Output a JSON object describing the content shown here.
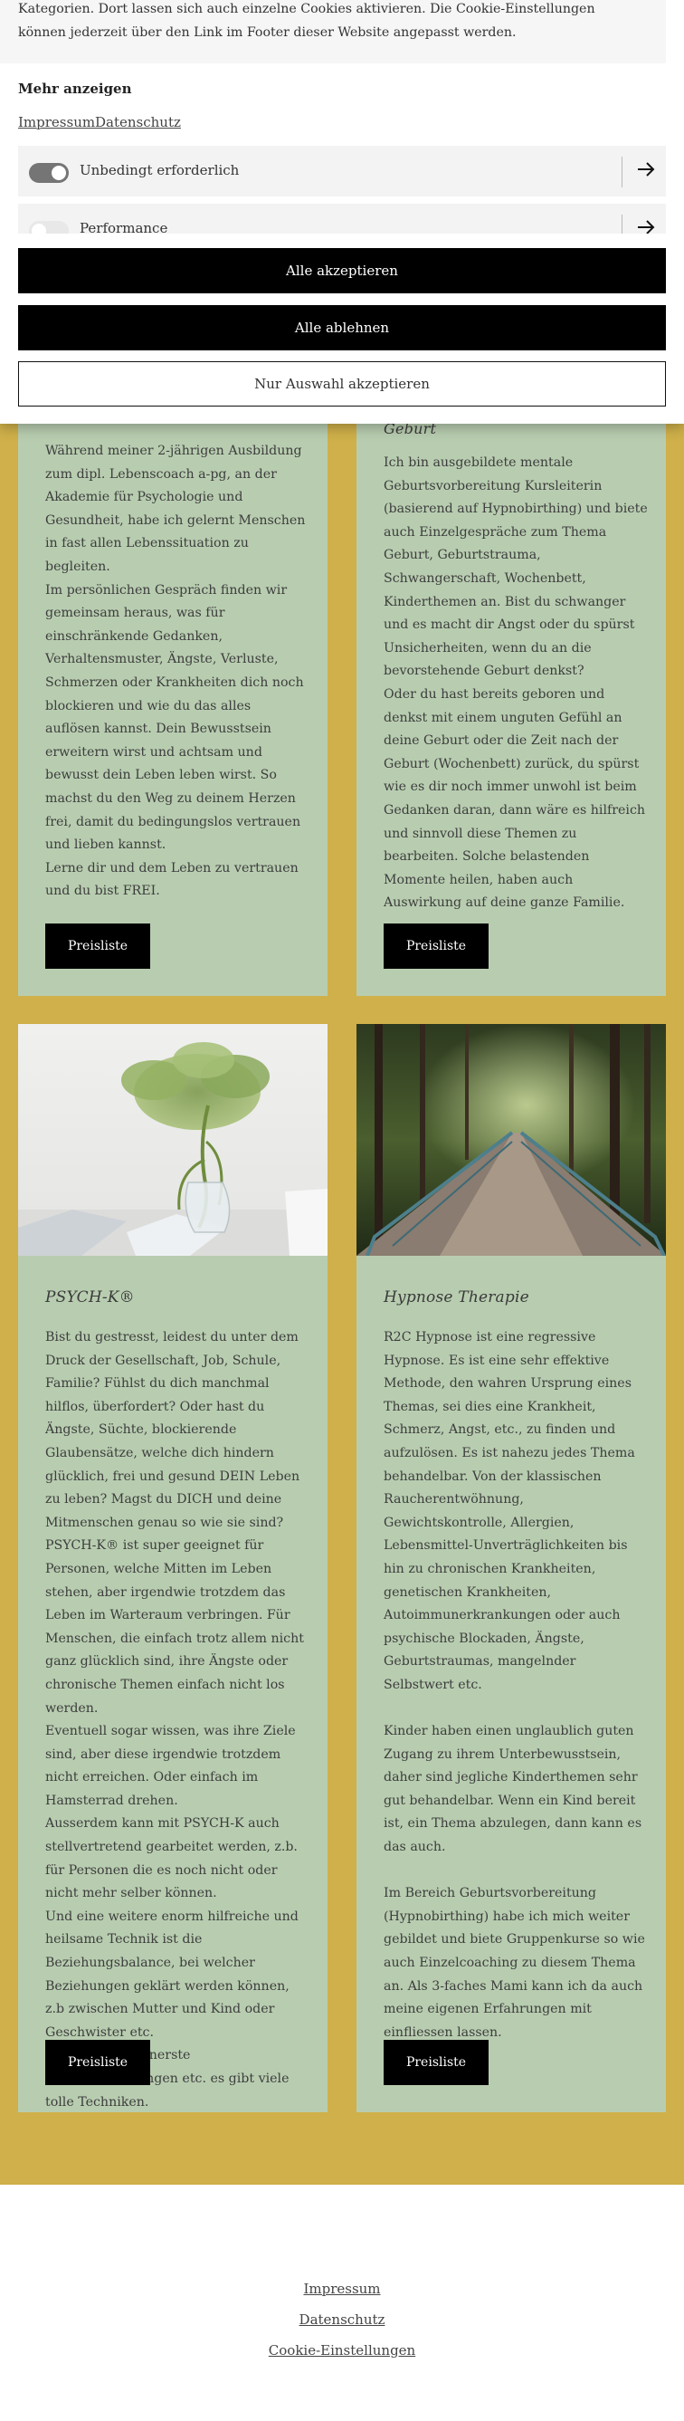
{
  "cookie_banner": {
    "intro_text": "Kategorien. Dort lassen sich auch einzelne Cookies aktivieren. Die Cookie-Einstellungen können jederzeit über den Link im Footer dieser Website angepasst werden.",
    "more_label": "Mehr anzeigen",
    "links": {
      "impressum": "Impressum",
      "datenschutz": "Datenschutz"
    },
    "categories": [
      {
        "label": "Unbedingt erforderlich",
        "enabled": true
      },
      {
        "label": "Performance",
        "enabled": false
      }
    ],
    "accept_all": "Alle akzeptieren",
    "reject_all": "Alle ablehnen",
    "accept_selection": "Nur Auswahl akzeptieren"
  },
  "cards": {
    "coaching": {
      "paragraphs": [
        "Während meiner 2-jährigen Ausbildung zum dipl. Lebenscoach a-pg, an der Akademie für Psychologie und Gesundheit, habe ich gelernt Menschen in fast allen Lebenssituation zu begleiten.",
        "Im persönlichen Gespräch finden wir gemeinsam heraus, was für einschränkende Gedanken, Verhaltensmuster, Ängste, Verluste, Schmerzen oder Krankheiten dich noch blockieren und wie du das alles auflösen kannst. Dein Bewusstsein erweitern wirst und achtsam und bewusst dein Leben leben wirst. So machst du den Weg zu deinem Herzen frei, damit du bedingungslos vertrauen und lieben kannst.",
        "Lerne dir und dem Leben zu vertrauen und du bist FREI."
      ],
      "button": "Preisliste"
    },
    "geburt": {
      "title_fragment": "Geburt",
      "paragraphs": [
        "Ich bin ausgebildete mentale Geburtsvorbereitung Kursleiterin (basierend auf Hypnobirthing) und biete auch Einzelgespräche zum Thema Geburt, Geburtstrauma, Schwangerschaft, Wochenbett, Kinderthemen an. Bist du schwanger und es macht dir Angst oder du spürst Unsicherheiten, wenn du an die bevorstehende Geburt denkst?",
        "Oder du hast bereits geboren und denkst mit einem unguten Gefühl an deine Geburt oder die Zeit nach der Geburt (Wochenbett) zurück, du spürst wie es dir noch immer unwohl ist beim Gedanken daran, dann wäre es hilfreich und sinnvoll diese Themen zu bearbeiten. Solche belastenden Momente heilen, haben auch Auswirkung auf deine ganze Familie."
      ],
      "button": "Preisliste"
    },
    "psychk": {
      "title": "PSYCH-K®",
      "paragraphs": [
        "Bist du gestresst, leidest du unter dem Druck der Gesellschaft, Job, Schule, Familie?  Fühlst du dich manchmal hilflos, überfordert?  Oder hast du Ängste, Süchte, blockierende Glaubensätze, welche dich hindern glücklich, frei und gesund DEIN Leben zu leben? Magst du DICH und deine Mitmenschen genau so wie sie sind?",
        "PSYCH-K® ist super geeignet für Personen, welche Mitten im Leben stehen, aber irgendwie trotzdem das Leben im Warteraum verbringen. Für Menschen, die einfach trotz allem nicht ganz glücklich sind, ihre Ängste oder chronische Themen einfach nicht los werden.",
        "Eventuell sogar wissen, was ihre Ziele sind, aber diese irgendwie trotzdem nicht erreichen. Oder einfach im Hamsterrad drehen.",
        "Ausserdem kann mit PSYCH-K auch stellvertretend gearbeitet werden, z.b. für Personen die es noch nicht oder nicht mehr selber können.",
        "Und eine weitere enorm hilfreiche und heilsame Technik ist die Beziehungsbalance, bei welcher Beziehungen geklärt werden können, z.b zwischen Mutter und Kind oder Geschwister etc.",
        "Life Bonding, innerste Kernüberzeugungen etc. es gibt viele tolle Techniken."
      ],
      "button": "Preisliste"
    },
    "hypnose": {
      "title": "Hypnose Therapie",
      "paragraphs": [
        "R2C Hypnose ist eine regressive Hypnose. Es ist eine sehr effektive Methode, den wahren Ursprung eines Themas, sei dies eine Krankheit, Schmerz, Angst, etc., zu finden und aufzulösen. Es ist nahezu jedes Thema behandelbar. Von der klassischen Raucherentwöhnung, Gewichtskontrolle, Allergien, Lebensmittel-Unverträglichkeiten bis hin zu chronischen Krankheiten, genetischen Krankheiten, Autoimmunerkrankungen oder auch psychische Blockaden, Ängste, Geburtstraumas, mangelnder Selbstwert etc.",
        "Kinder haben einen unglaublich guten Zugang zu ihrem Unterbewusstsein, daher sind jegliche Kinderthemen sehr gut behandelbar. Wenn ein Kind bereit ist, ein Thema abzulegen, dann kann es das auch.",
        "Im Bereich Geburtsvorbereitung (Hypnobirthing) habe ich mich weiter gebildet und biete Gruppenkurse so wie auch Einzelcoaching zu diesem Thema an. Als 3-faches Mami kann ich da auch meine eigenen Erfahrungen mit einfliessen lassen."
      ],
      "button": "Preisliste"
    }
  },
  "footer": {
    "impressum": "Impressum",
    "datenschutz": "Datenschutz",
    "cookie_settings": "Cookie-Einstellungen"
  },
  "colors": {
    "section_background": "#cfb04a",
    "card_background": "#b8cdb0",
    "button_background": "#000000"
  },
  "icons": [
    "arrow-right-icon",
    "toggle-switch"
  ]
}
